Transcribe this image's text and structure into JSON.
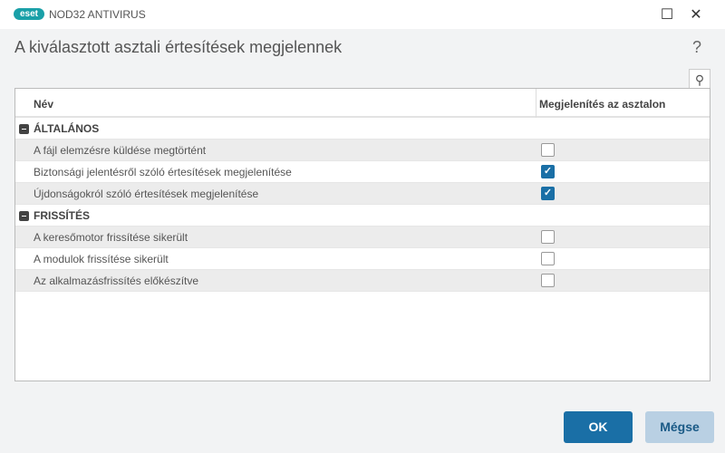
{
  "app": {
    "logo": "eset",
    "title": "NOD32 ANTIVIRUS"
  },
  "heading": "A kiválasztott asztali értesítések megjelennek",
  "help": "?",
  "table": {
    "columns": [
      "Név",
      "Megjelenítés az asztalon"
    ],
    "groups": [
      {
        "name": "ÁLTALÁNOS",
        "items": [
          {
            "label": "A fájl elemzésre küldése megtörtént",
            "checked": false
          },
          {
            "label": "Biztonsági jelentésről szóló értesítések megjelenítése",
            "checked": true
          },
          {
            "label": "Újdonságokról szóló értesítések megjelenítése",
            "checked": true
          }
        ]
      },
      {
        "name": "FRISSÍTÉS",
        "items": [
          {
            "label": "A keresőmotor frissítése sikerült",
            "checked": false
          },
          {
            "label": "A modulok frissítése sikerült",
            "checked": false
          },
          {
            "label": "Az alkalmazásfrissítés előkészítve",
            "checked": false
          }
        ]
      }
    ]
  },
  "buttons": {
    "ok": "OK",
    "cancel": "Mégse"
  }
}
